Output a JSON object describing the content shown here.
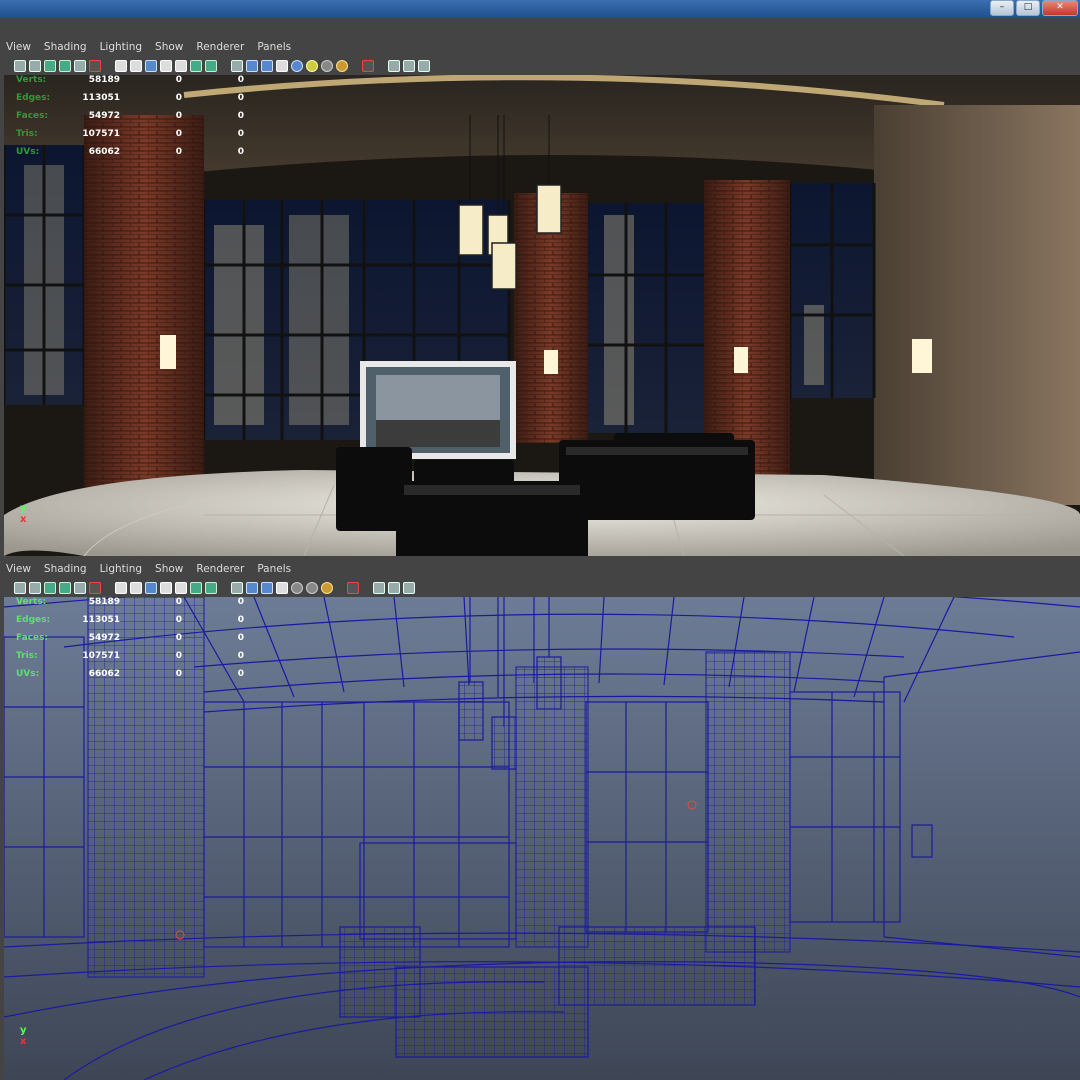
{
  "menu": [
    "View",
    "Shading",
    "Lighting",
    "Show",
    "Renderer",
    "Panels"
  ],
  "window_buttons": [
    "minimize-icon",
    "maximize-icon",
    "close-icon"
  ],
  "toolbar_icons": [
    "select-camera-icon",
    "camera-attributes-icon",
    "bookmark-icon",
    "image-plane-icon",
    "2d-pan-zoom-icon",
    "grease-pencil-icon",
    "grid-icon",
    "film-gate-icon",
    "resolution-gate-icon",
    "field-chart-icon",
    "safe-action-icon",
    "safe-title-icon",
    "wireframe-icon",
    "smooth-shade-icon",
    "textured-icon",
    "use-lights-icon",
    "shadows-icon",
    "ambient-occlusion-icon",
    "motion-blur-icon",
    "isolate-select-icon",
    "xray-icon",
    "xray-joints-icon",
    "xray-active-icon"
  ],
  "hud": {
    "rows": [
      {
        "label": "Verts:",
        "v1": "58189",
        "v2": "0",
        "v3": "0"
      },
      {
        "label": "Edges:",
        "v1": "113051",
        "v2": "0",
        "v3": "0"
      },
      {
        "label": "Faces:",
        "v1": "54972",
        "v2": "0",
        "v3": "0"
      },
      {
        "label": "Tris:",
        "v1": "107571",
        "v2": "0",
        "v3": "0"
      },
      {
        "label": "UVs:",
        "v1": "66062",
        "v2": "0",
        "v3": "0"
      }
    ]
  },
  "axis": {
    "y": "y",
    "x": "x"
  },
  "colors": {
    "wire": "#1a1aa0",
    "viewport_bg": "#5c6a82",
    "hud_label": "#2f9a3a"
  }
}
